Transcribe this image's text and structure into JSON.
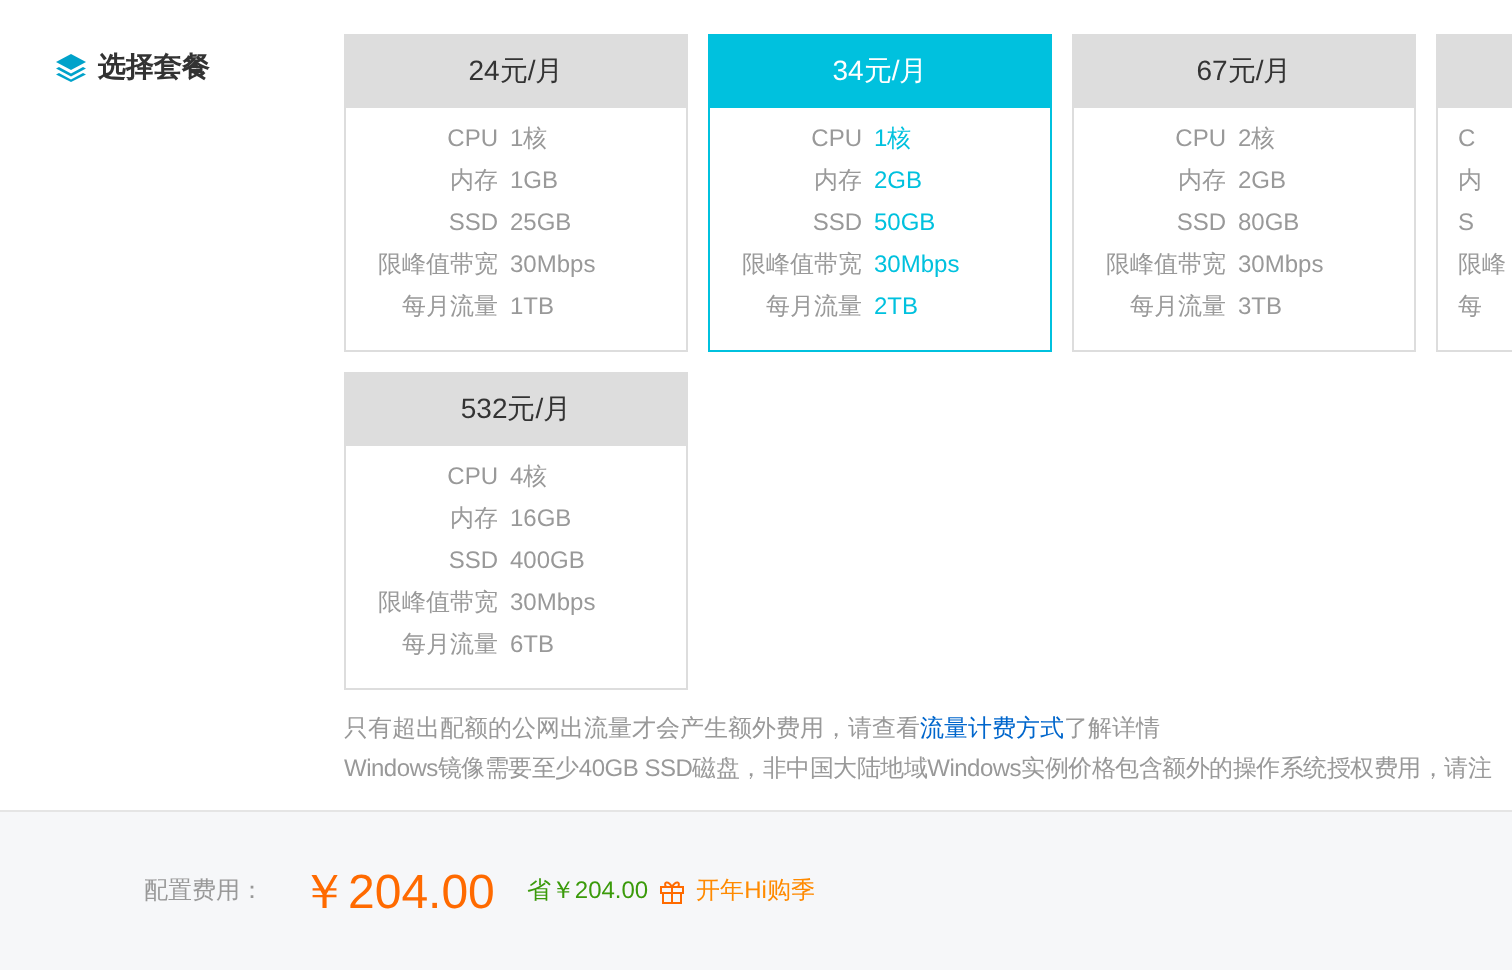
{
  "section": {
    "title": "选择套餐"
  },
  "plans": [
    {
      "kind": "full",
      "price": "24元/月",
      "selected": false,
      "specs": [
        {
          "label": "CPU",
          "value": "1核"
        },
        {
          "label": "内存",
          "value": "1GB"
        },
        {
          "label": "SSD",
          "value": "25GB"
        },
        {
          "label": "限峰值带宽",
          "value": "30Mbps"
        },
        {
          "label": "每月流量",
          "value": "1TB"
        }
      ]
    },
    {
      "kind": "full",
      "price": "34元/月",
      "selected": true,
      "specs": [
        {
          "label": "CPU",
          "value": "1核"
        },
        {
          "label": "内存",
          "value": "2GB"
        },
        {
          "label": "SSD",
          "value": "50GB"
        },
        {
          "label": "限峰值带宽",
          "value": "30Mbps"
        },
        {
          "label": "每月流量",
          "value": "2TB"
        }
      ]
    },
    {
      "kind": "full",
      "price": "67元/月",
      "selected": false,
      "specs": [
        {
          "label": "CPU",
          "value": "2核"
        },
        {
          "label": "内存",
          "value": "2GB"
        },
        {
          "label": "SSD",
          "value": "80GB"
        },
        {
          "label": "限峰值带宽",
          "value": "30Mbps"
        },
        {
          "label": "每月流量",
          "value": "3TB"
        }
      ]
    },
    {
      "kind": "clipped",
      "selected": false,
      "specs": [
        {
          "label": "C"
        },
        {
          "label": "内"
        },
        {
          "label": "S"
        },
        {
          "label": "限峰"
        },
        {
          "label": "每"
        }
      ]
    },
    {
      "kind": "full",
      "price": "532元/月",
      "selected": false,
      "specs": [
        {
          "label": "CPU",
          "value": "4核"
        },
        {
          "label": "内存",
          "value": "16GB"
        },
        {
          "label": "SSD",
          "value": "400GB"
        },
        {
          "label": "限峰值带宽",
          "value": "30Mbps"
        },
        {
          "label": "每月流量",
          "value": "6TB"
        }
      ]
    }
  ],
  "notes": {
    "traffic": {
      "before": "只有超出配额的公网出流量才会产生额外费用，请查看",
      "link": "流量计费方式",
      "after": "了解详情"
    },
    "windows": "Windows镜像需要至少40GB SSD磁盘，非中国大陆地域Windows实例价格包含额外的操作系统授权费用，请注"
  },
  "footer": {
    "label": "配置费用：",
    "price": "￥204.00",
    "saving": "省￥204.00",
    "promo": "开年Hi购季"
  }
}
